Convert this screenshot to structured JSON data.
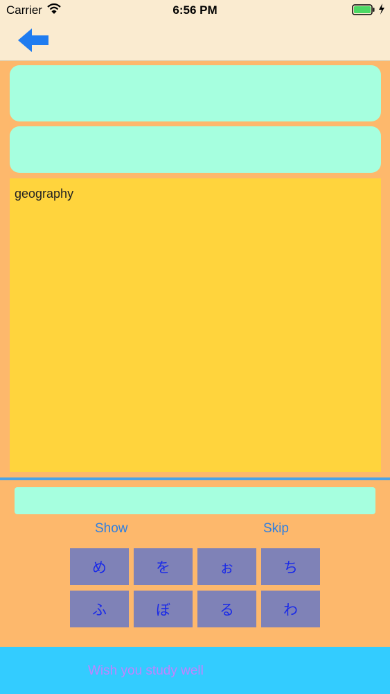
{
  "status_bar": {
    "carrier": "Carrier",
    "time": "6:56 PM"
  },
  "nav": {
    "back_icon": "back-arrow-icon",
    "accent_color": "#1f7cf0"
  },
  "question": {
    "text": "geography"
  },
  "actions": {
    "show_label": "Show",
    "skip_label": "Skip"
  },
  "keyboard": {
    "keys": [
      "め",
      "を",
      "ぉ",
      "ち",
      "ふ",
      "ぼ",
      "る",
      "わ"
    ]
  },
  "footer": {
    "text": "Wish you study well"
  },
  "colors": {
    "background": "#fdb86c",
    "card": "#a6ffdf",
    "question_bg": "#ffd43d",
    "footer_bg": "#33ccff",
    "key_bg": "#7f82b7"
  }
}
